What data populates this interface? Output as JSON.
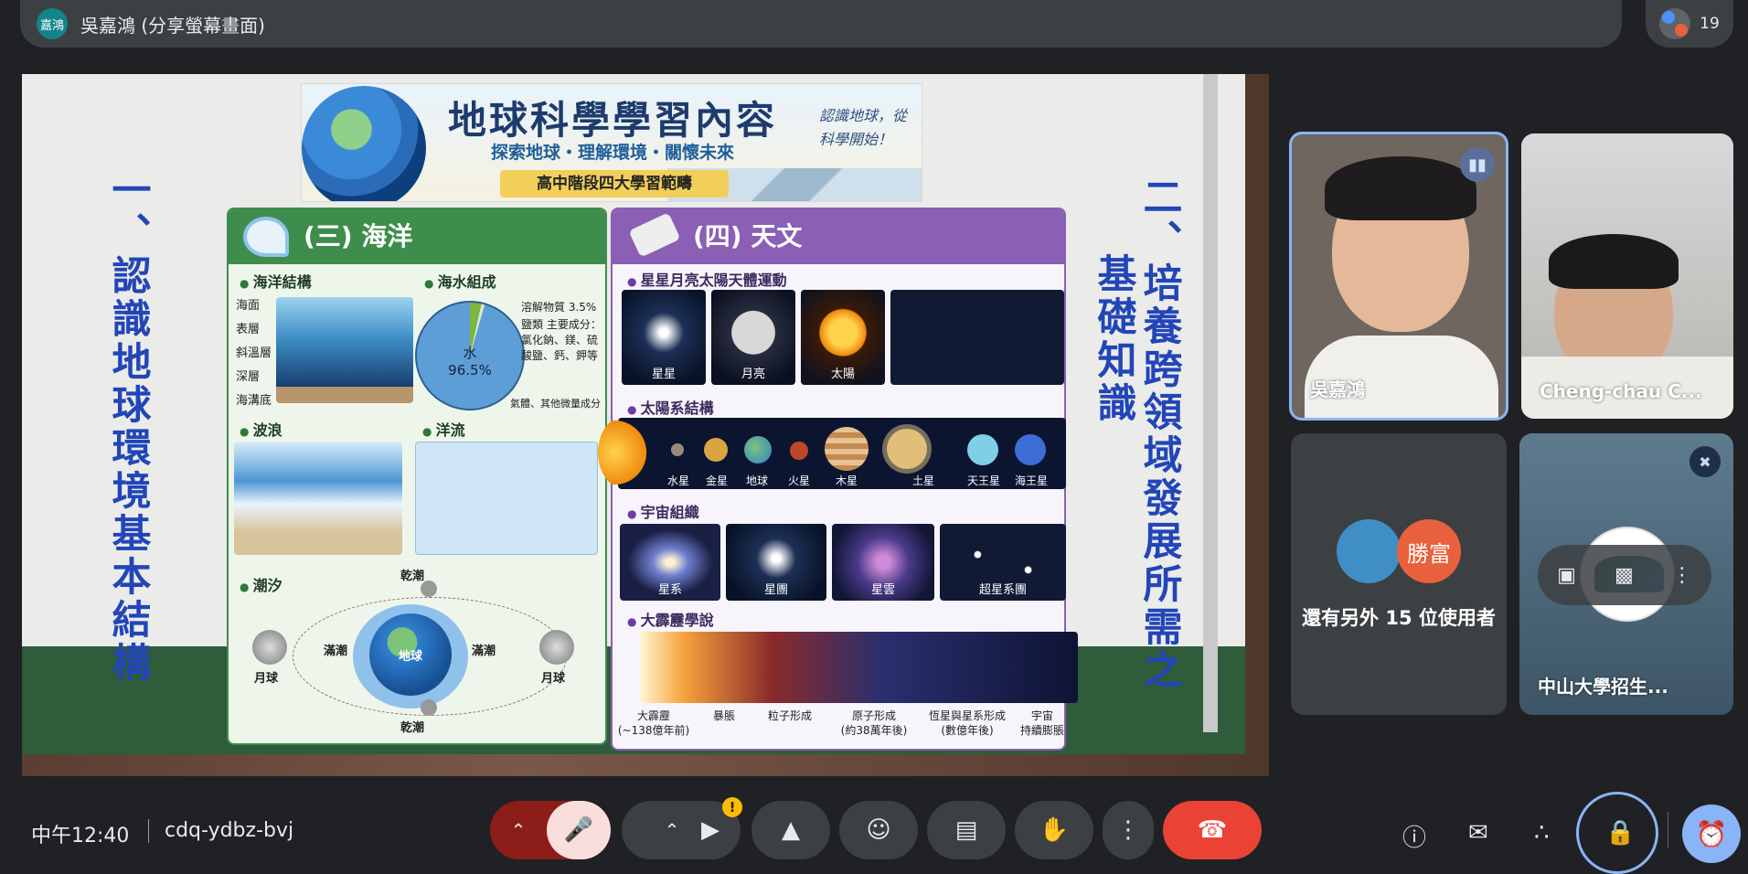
{
  "presenter": {
    "avatar_text": "嘉鴻",
    "title": "吳嘉鴻 (分享螢幕畫面)"
  },
  "participants_count": "19",
  "slide": {
    "left_vertical": "一、認識地球環境基本結構",
    "right_vertical_1": "二、培養跨領域發展所需之",
    "right_vertical_2": "基礎知識",
    "banner": {
      "title": "地球科學學習內容",
      "subtitle": "探索地球・理解環境・關懷未來",
      "tag": "高中階段四大學習範疇",
      "note": "認識地球，從科學開始！"
    },
    "ocean": {
      "title": "(三) 海洋",
      "structure_title": "海洋結構",
      "layers": [
        "海面",
        "表層",
        "斜溫層",
        "深層",
        "海溝底"
      ],
      "water_title": "海水組成",
      "pie_label": "水\n96.5%",
      "dissolved": "溶解物質 3.5%",
      "salts": "鹽類 主要成分：氯化鈉、鎂、硫酸鹽、鈣、鉀等",
      "gas": "氣體、其他微量成分",
      "waves": "波浪",
      "currents": "洋流",
      "tides": "潮汐",
      "tide_labels": {
        "dry_top": "乾潮",
        "dry_bottom": "乾潮",
        "full_left": "滿潮",
        "full_right": "滿潮",
        "earth": "地球",
        "moon_left": "月球",
        "moon_right": "月球"
      }
    },
    "astronomy": {
      "title": "(四) 天文",
      "motion_title": "星星月亮太陽天體運動",
      "motion_tiles": [
        "星星",
        "月亮",
        "太陽"
      ],
      "solar_title": "太陽系結構",
      "planets": [
        "水星",
        "金星",
        "地球",
        "火星",
        "木星",
        "土星",
        "天王星",
        "海王星"
      ],
      "cosmos_title": "宇宙組織",
      "cosmos_tiles": [
        "星系",
        "星團",
        "星雲",
        "超星系團"
      ],
      "bigbang_title": "大霹靂學說",
      "bigbang_stages": [
        "大霹靂\n(~138億年前)",
        "暴脹",
        "粒子形成",
        "原子形成\n(約38萬年後)",
        "恆星與星系形成\n(數億年後)",
        "宇宙\n持續膨脹"
      ]
    }
  },
  "tiles": {
    "t1_name": "吳嘉鴻",
    "t2_name": "Cheng-chau C...",
    "t3_avatar": "勝富",
    "t3_text": "還有另外 15 位使用者",
    "t4_name": "中山大學招生..."
  },
  "bottom": {
    "time": "中午12:40",
    "meeting_code": "cdq-ydbz-bvj"
  }
}
